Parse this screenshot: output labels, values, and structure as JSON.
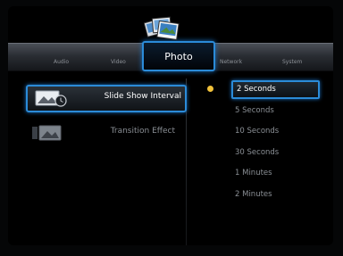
{
  "tabs": [
    {
      "label": "Audio"
    },
    {
      "label": "Video"
    },
    {
      "label": "Photo"
    },
    {
      "label": "Network"
    },
    {
      "label": "System"
    }
  ],
  "menu": [
    {
      "label": "Slide Show Interval",
      "icon": "photo-clock-icon"
    },
    {
      "label": "Transition Effect",
      "icon": "photo-transition-icon"
    }
  ],
  "options": [
    "2 Seconds",
    "5 Seconds",
    "10 Seconds",
    "30 Seconds",
    "1 Minutes",
    "2 Minutes"
  ],
  "colors": {
    "accent": "#2b8bd8",
    "bullet": "#f2c23a"
  }
}
